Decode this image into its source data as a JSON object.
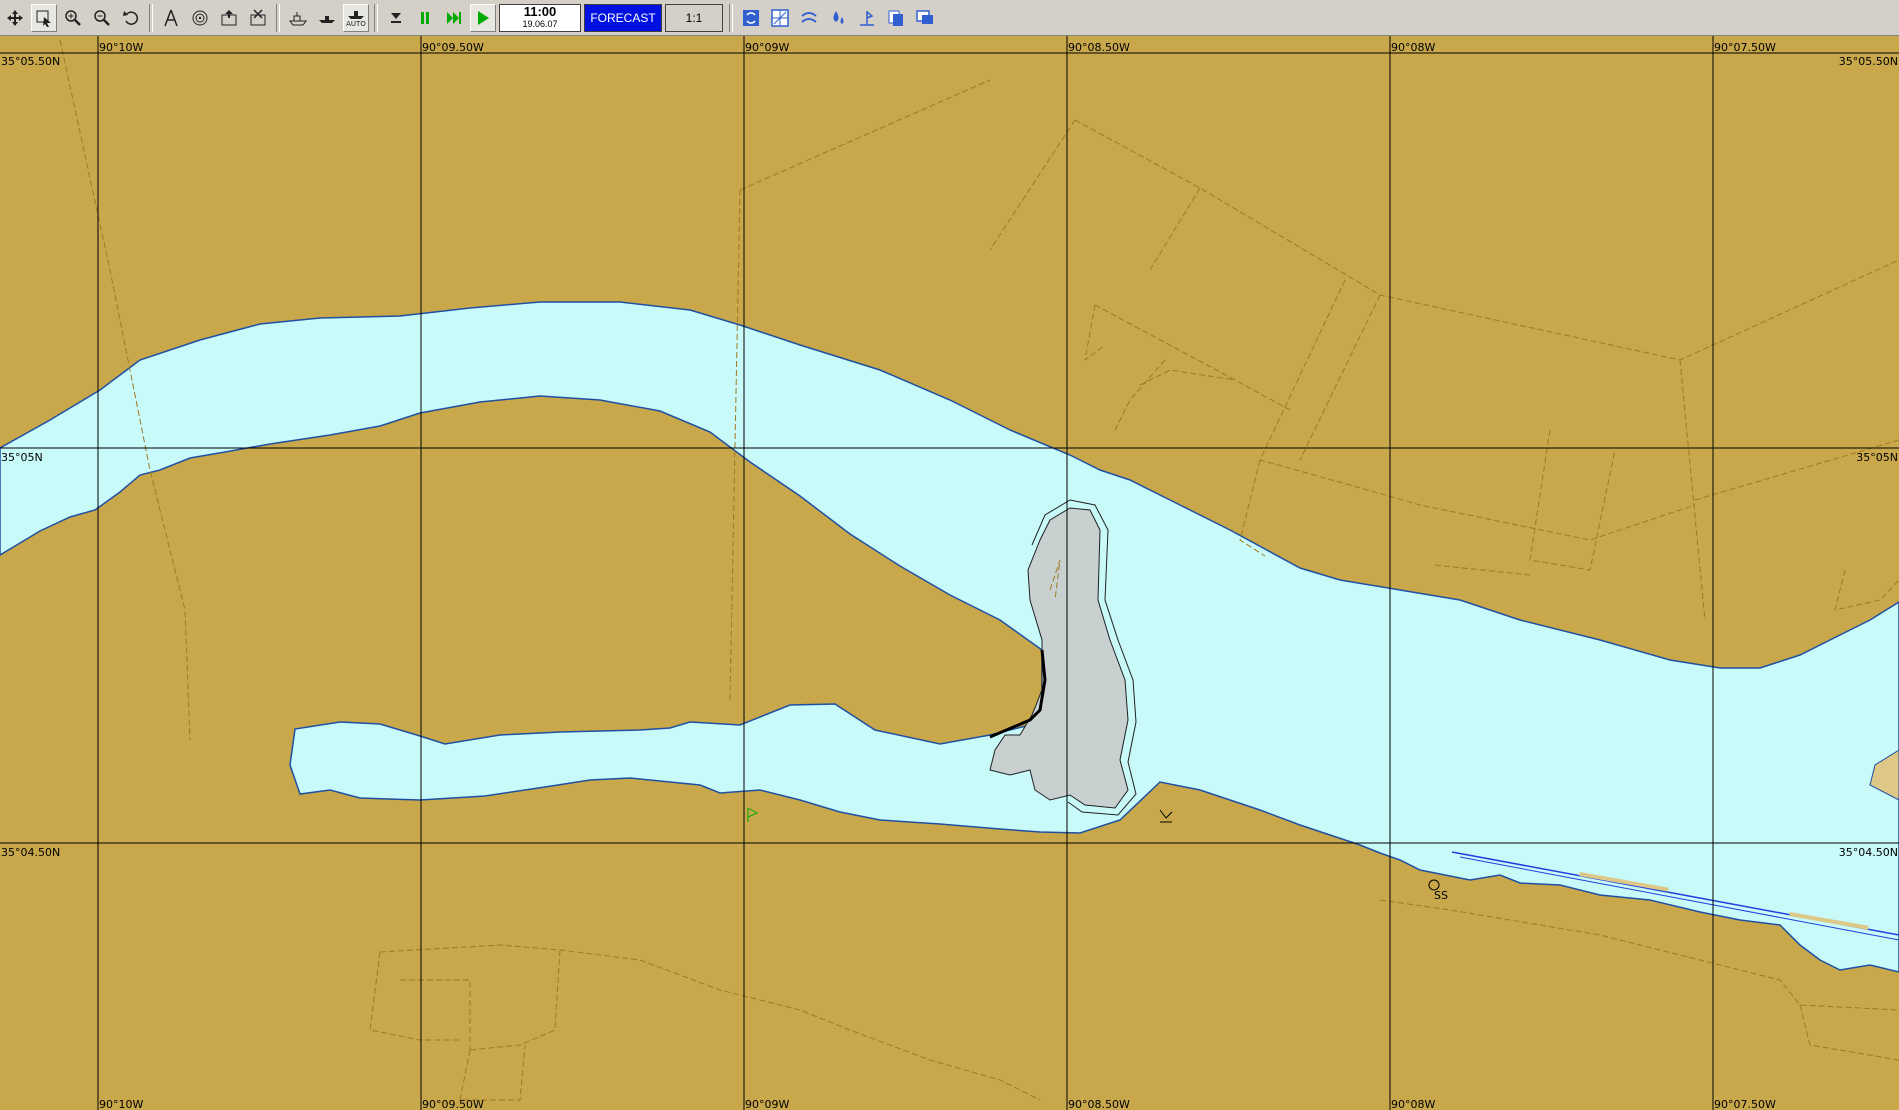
{
  "toolbar": {
    "buttons": [
      {
        "name": "move-tool",
        "icon": "move-icon"
      },
      {
        "name": "select-tool",
        "icon": "select-icon",
        "pressed": true
      },
      {
        "name": "zoom-in",
        "icon": "zoom-in-icon"
      },
      {
        "name": "zoom-out",
        "icon": "zoom-out-icon"
      },
      {
        "name": "undo",
        "icon": "undo-icon"
      },
      {
        "name": "measure",
        "icon": "compass-icon"
      },
      {
        "name": "target",
        "icon": "target-icon"
      },
      {
        "name": "chart-load",
        "icon": "chart-load-icon"
      },
      {
        "name": "chart-remove",
        "icon": "chart-remove-icon"
      },
      {
        "name": "ship",
        "icon": "ship-icon"
      },
      {
        "name": "ship-ahead",
        "icon": "ship-ahead-icon"
      },
      {
        "name": "auto",
        "icon": "auto-ship-icon"
      },
      {
        "name": "stop",
        "icon": "stop-icon"
      },
      {
        "name": "pause",
        "icon": "pause-icon"
      },
      {
        "name": "fast-forward",
        "icon": "fast-forward-icon"
      },
      {
        "name": "play",
        "icon": "play-icon",
        "pressed": true
      }
    ],
    "auto_label": "AUTO",
    "time": "11:00",
    "date": "19.06.07",
    "forecast_label": "FORECAST",
    "scale_label": "1:1",
    "right_buttons": [
      "refresh-icon",
      "grid-icon",
      "weather-icon",
      "water-icon",
      "wind-icon",
      "layers-icon",
      "window-icon"
    ]
  },
  "map": {
    "colors": {
      "land": "#c8a84b",
      "water": "#c8fafa",
      "shoreline": "#2050a0",
      "grid": "#000000",
      "dashed_line": "#a07a20",
      "island": "#c8d0d0"
    },
    "longitude_labels": [
      "90°10W",
      "90°09.50W",
      "90°09W",
      "90°08.50W",
      "90°08W",
      "90°07.50W"
    ],
    "latitude_labels": [
      "35°05.50N",
      "35°05N",
      "35°04.50N"
    ],
    "symbols": {
      "station_label": "SS"
    }
  }
}
